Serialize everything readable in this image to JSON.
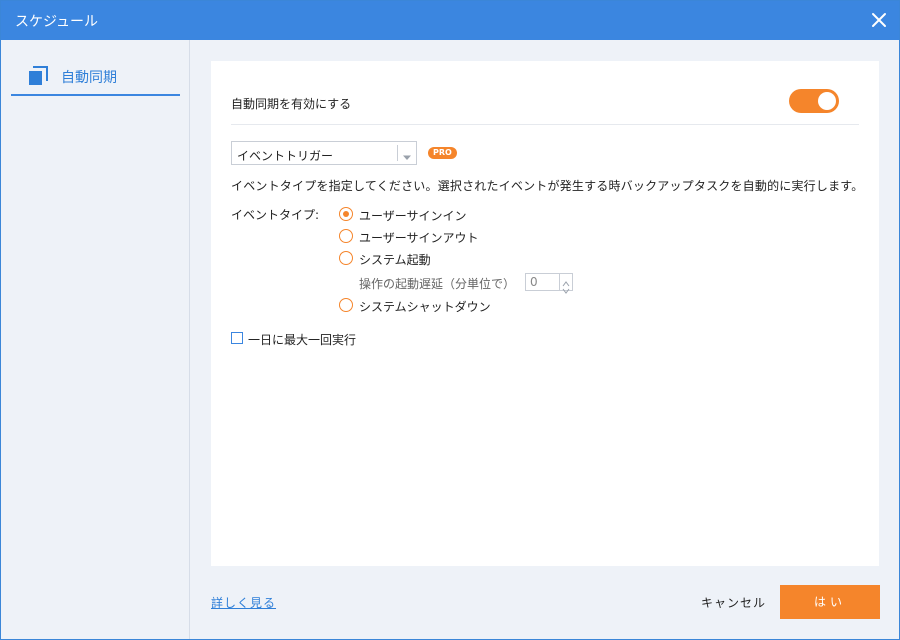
{
  "window": {
    "title": "スケジュール"
  },
  "icons": {
    "close": "close-icon",
    "sync": "copy-squares-icon",
    "dropdown": "chevron-down-icon"
  },
  "colors": {
    "titlebar": "#3b86e0",
    "accent": "#f5852b",
    "link": "#2f7fd8"
  },
  "sidebar": {
    "items": [
      {
        "label": "自動同期",
        "active": true
      }
    ]
  },
  "panel": {
    "enable_label": "自動同期を有効にする",
    "enable_on": true,
    "trigger_select": {
      "value": "イベントトリガー"
    },
    "pro_badge": "PRO",
    "description": "イベントタイプを指定してください。選択されたイベントが発生する時バックアップタスクを自動的に実行します。",
    "event_type_label": "イベントタイプ:",
    "event_options": [
      {
        "label": "ユーザーサインイン",
        "checked": true
      },
      {
        "label": "ユーザーサインアウト",
        "checked": false
      },
      {
        "label": "システム起動",
        "checked": false
      },
      {
        "label": "システムシャットダウン",
        "checked": false
      }
    ],
    "delay_label": "操作の起動遅延（分単位で）",
    "delay_value": "0",
    "once_per_day_label": "一日に最大一回実行",
    "once_per_day_checked": false
  },
  "footer": {
    "learn_more": "詳しく見る",
    "cancel": "キャンセル",
    "ok": "はい"
  }
}
